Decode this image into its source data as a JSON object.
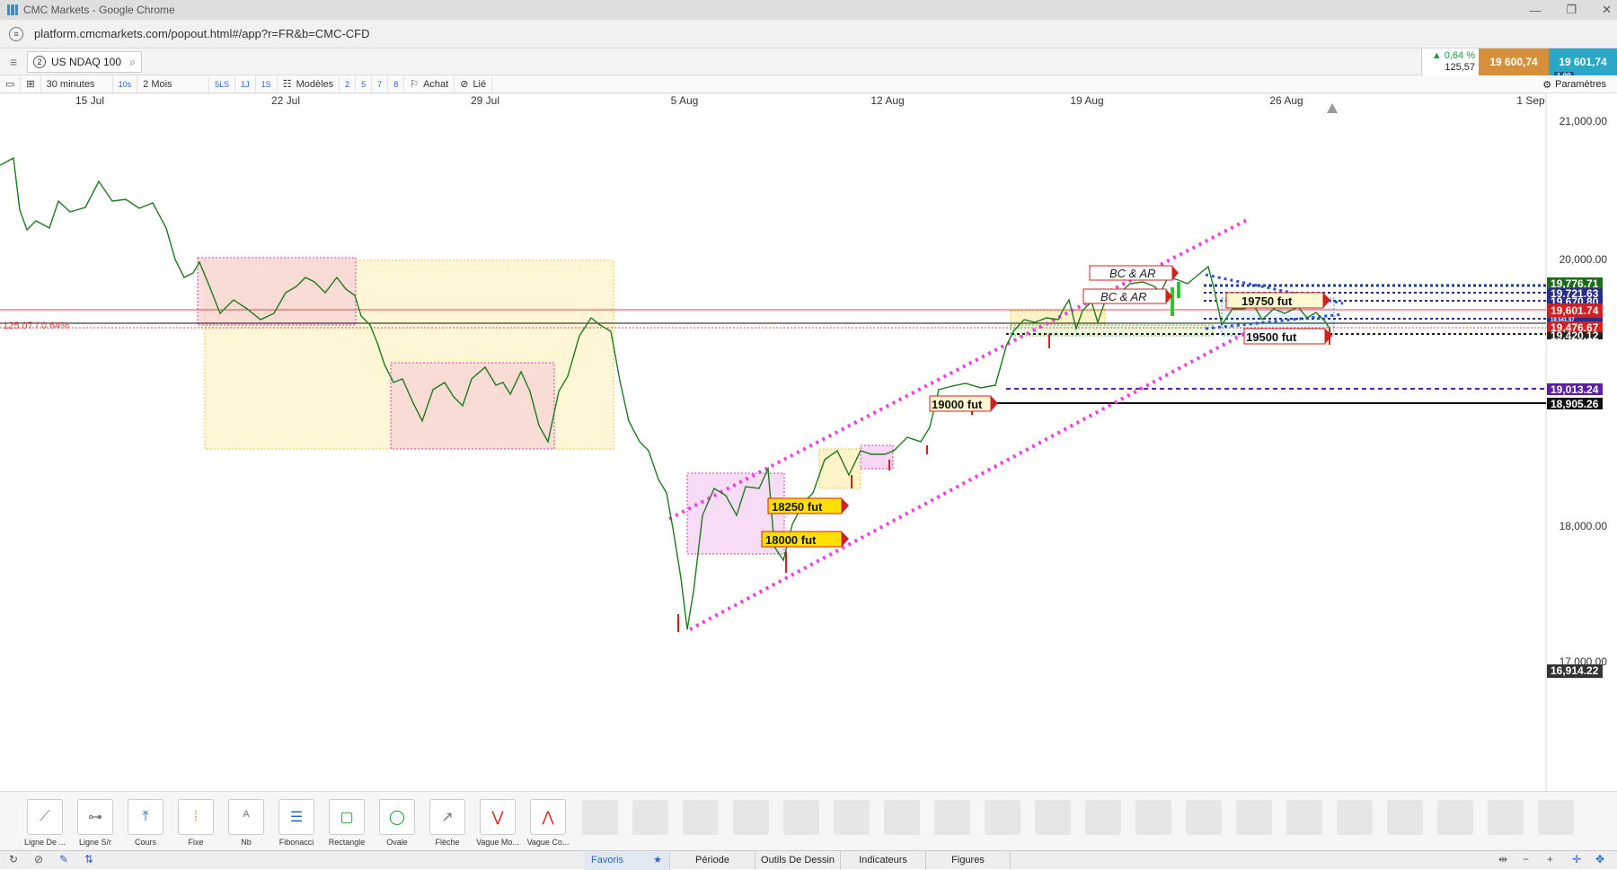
{
  "window": {
    "title": "CMC Markets - Google Chrome",
    "controls": [
      "—",
      "❐",
      "✕"
    ]
  },
  "address": {
    "url": "platform.cmcmarkets.com/popout.html#/app?r=FR&b=CMC-CFD"
  },
  "header": {
    "instrument_index": "2",
    "instrument_name": "US NDAQ 100",
    "change_pct": "▲ 0,64 %",
    "change_abs": "125,57",
    "sell_price": "19 600,74",
    "buy_price": "19 601,74",
    "spread": "1.00"
  },
  "toolbar": {
    "interval": "30 minutes",
    "interval_short": "10s",
    "range": "2 Mois",
    "quick_ranges": [
      "5LS",
      "1J",
      "1S"
    ],
    "templates": "Modèles",
    "template_slots": [
      "2",
      "5",
      "7",
      "8"
    ],
    "buy_label": "Achat",
    "link_label": "Lié",
    "settings": "Paramètres"
  },
  "chart": {
    "date_labels": [
      "15 Jul",
      "22 Jul",
      "29 Jul",
      "5 Aug",
      "12 Aug",
      "19 Aug",
      "26 Aug",
      "1 Sep"
    ],
    "price_labels": [
      "21,000.00",
      "20,000.00",
      "18,000.00",
      "17,000.00"
    ],
    "line_labels": [
      {
        "text": "19,776.71",
        "bg": "#1e6b1e"
      },
      {
        "text": "19,721.63",
        "bg": "#2b2b8c"
      },
      {
        "text": "19,670.80",
        "bg": "#2b2b8c"
      },
      {
        "text": "19,601.74",
        "bg": "#d12020"
      },
      {
        "text": "19,541.57",
        "bg": "#2b2b8c"
      },
      {
        "text": "19,476.67",
        "bg": "#d12020"
      },
      {
        "text": "19,420.12",
        "bg": "#222222"
      },
      {
        "text": "19,013.24",
        "bg": "#5b1fa6"
      },
      {
        "text": "18,905.26",
        "bg": "#111111"
      },
      {
        "text": "16,914.22",
        "bg": "#333333"
      }
    ],
    "change_label": "125.07 / 0.64%",
    "annotations": [
      "BC & AR",
      "BC & AR",
      "19750 fut",
      "19500 fut",
      "19000 fut",
      "18250 fut",
      "18000 fut"
    ]
  },
  "tools": [
    {
      "label": "Ligne De ...",
      "icon": "trendline-icon"
    },
    {
      "label": "Ligne S/r",
      "icon": "sr-line-icon"
    },
    {
      "label": "Cours",
      "icon": "price-line-icon"
    },
    {
      "label": "Fixe",
      "icon": "fixed-line-icon"
    },
    {
      "label": "Nb",
      "icon": "text-note-icon"
    },
    {
      "label": "Fibonacci",
      "icon": "fibonacci-icon"
    },
    {
      "label": "Rectangle",
      "icon": "rectangle-icon"
    },
    {
      "label": "Ovale",
      "icon": "oval-icon"
    },
    {
      "label": "Flèche",
      "icon": "arrow-icon"
    },
    {
      "label": "Vague Mo...",
      "icon": "wave-icon"
    },
    {
      "label": "Vague Co...",
      "icon": "corrective-wave-icon"
    }
  ],
  "tabs": [
    "Favoris",
    "Période",
    "Outils De Dessin",
    "Indicateurs",
    "Figures"
  ],
  "zoom": {
    "minus": "−",
    "plus": "+"
  }
}
